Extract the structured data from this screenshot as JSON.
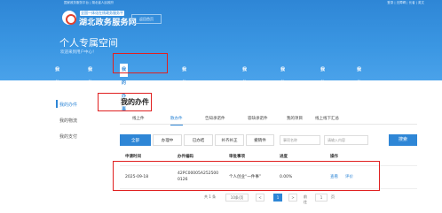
{
  "topbar": {
    "left": "国家政务服务平台 | 湖北省人民政府",
    "right": "登录 | 无障碍 | 长者 | 英文"
  },
  "brand": {
    "badge": "全国一体化在线政务服务平台",
    "name": "湖北政务服务网",
    "return_home": "返回首页"
  },
  "hero": {
    "title": "个人专属空间",
    "subtitle": "欢迎来到用户中心！"
  },
  "nav": [
    "我的主页",
    "我的主页",
    "我的办事",
    "我的证照材料",
    "我的评价",
    "我的互动",
    "我的收藏",
    "我的足迹"
  ],
  "sidebar": [
    "我的办件",
    "我的物流",
    "我的支付"
  ],
  "page_title": "我的办件",
  "tabs": [
    "线上件",
    "散办件",
    "告知承诺件",
    "容缺承诺件",
    "我的项目",
    "线上线下汇总"
  ],
  "filters": {
    "buttons": [
      "全部",
      "办理中",
      "已办结",
      "补齐补正",
      "撤销件"
    ],
    "select_placeholder": "事项名称",
    "search_placeholder": "请输入内容",
    "search_label": "搜索"
  },
  "table": {
    "headers": [
      "申请时间",
      "办件编码",
      "审批事项",
      "进度",
      "操作"
    ],
    "rows": [
      {
        "time": "2025-09-18",
        "code_line1": "42PC00005A252500",
        "code_line2": "0126",
        "item": "个人创业“一件事”",
        "progress": "0.00%",
        "actions": [
          "查看",
          "评价"
        ]
      }
    ]
  },
  "pager": {
    "total": "共 1 条",
    "page_size": "10条/页",
    "prev": "<",
    "current": "1",
    "next": ">",
    "goto_label": "前往",
    "goto_value": "1",
    "goto_suffix": "页"
  }
}
